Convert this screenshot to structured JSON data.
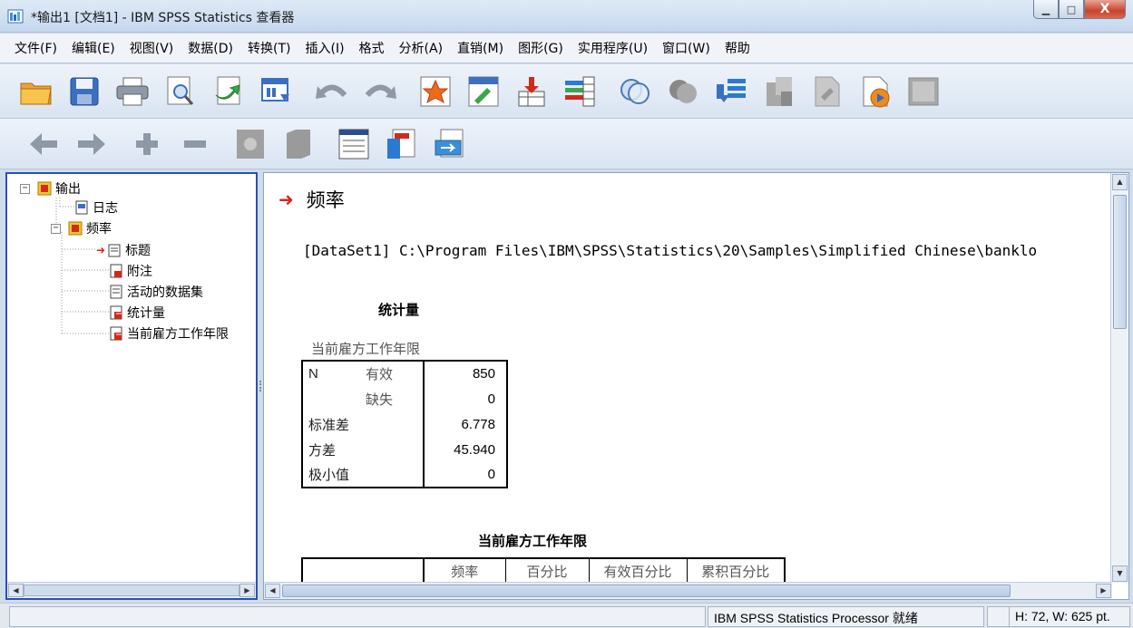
{
  "window": {
    "title": "*输出1 [文档1] - IBM SPSS Statistics 查看器",
    "minimize_glyph": "▁",
    "maximize_glyph": "□",
    "close_glyph": "X"
  },
  "menu": [
    "文件(F)",
    "编辑(E)",
    "视图(V)",
    "数据(D)",
    "转换(T)",
    "插入(I)",
    "格式",
    "分析(A)",
    "直销(M)",
    "图形(G)",
    "实用程序(U)",
    "窗口(W)",
    "帮助"
  ],
  "toolbar1_icons": [
    "open-folder-icon",
    "save-icon",
    "print-icon",
    "print-preview-icon",
    "export-icon",
    "recall-dialog-icon",
    "undo-icon",
    "redo-icon",
    "goto-case-icon",
    "goto-variable-icon",
    "insert-cases-icon",
    "variables-icon",
    "show-all-variables-icon",
    "select-cases-icon",
    "use-variable-sets-icon",
    "split-file-icon",
    "weight-cases-icon",
    "value-labels-icon",
    "spell-check-icon"
  ],
  "toolbar2_icons": [
    "back-arrow-icon",
    "forward-arrow-icon",
    "expand-icon",
    "collapse-icon",
    "show-icon",
    "hide-icon",
    "insert-heading-icon",
    "insert-title-icon",
    "insert-text-icon"
  ],
  "outline": {
    "nodes": [
      {
        "label": "输出",
        "expander": "−"
      },
      {
        "label": "日志"
      },
      {
        "label": "频率",
        "expander": "−"
      },
      {
        "label": "标题"
      },
      {
        "label": "附注"
      },
      {
        "label": "活动的数据集"
      },
      {
        "label": "统计量"
      },
      {
        "label": "当前雇方工作年限"
      }
    ]
  },
  "content": {
    "heading": "频率",
    "dataset_path": "[DataSet1] C:\\Program Files\\IBM\\SPSS\\Statistics\\20\\Samples\\Simplified Chinese\\banklo",
    "stats_table": {
      "title": "统计量",
      "caption": "当前雇方工作年限",
      "rows": [
        {
          "a": "N",
          "b": "有效",
          "value": "850"
        },
        {
          "a": "",
          "b": "缺失",
          "value": "0"
        },
        {
          "a": "标准差",
          "b": "",
          "value": "6.778"
        },
        {
          "a": "方差",
          "b": "",
          "value": "45.940"
        },
        {
          "a": "极小值",
          "b": "",
          "value": "0"
        }
      ]
    },
    "freq_table": {
      "title": "当前雇方工作年限",
      "headers": [
        "频率",
        "百分比",
        "有效百分比",
        "累积百分比"
      ]
    }
  },
  "statusbar": {
    "processor": "IBM SPSS Statistics Processor 就绪",
    "dimensions": "H: 72, W: 625 pt."
  }
}
